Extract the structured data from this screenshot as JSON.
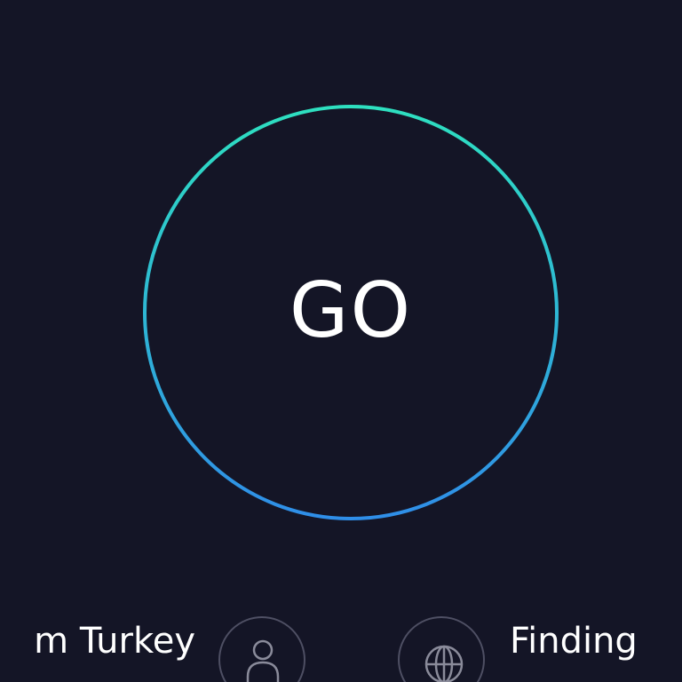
{
  "go_button": {
    "label": "GO",
    "ring_gradient": [
      "#2ee0c0",
      "#2f8ee8"
    ]
  },
  "connections": {
    "isp_name": "m Turkey",
    "user_icon": "user-icon",
    "globe_icon": "globe-icon",
    "server_name": "Finding"
  },
  "colors": {
    "background": "#141526",
    "text": "#ffffff",
    "icon_border": "#4e4f63"
  }
}
